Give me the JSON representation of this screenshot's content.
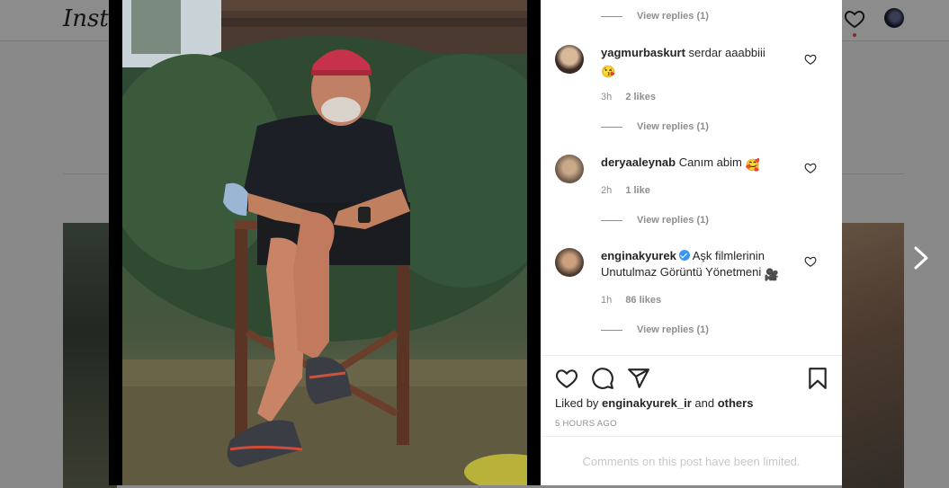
{
  "app": {
    "logo": "Instagram"
  },
  "post": {
    "comments": [
      {
        "user": "yagmurbaskurt",
        "text": "serdar aaabbiii",
        "emoji": "😘",
        "time": "3h",
        "likes": "2 likes",
        "view_replies": "View replies (1)",
        "verified": false
      },
      {
        "user": "deryaaleynab",
        "text": "Canım abim",
        "emoji": "🥰",
        "time": "2h",
        "likes": "1 like",
        "view_replies": "View replies (1)",
        "verified": false
      },
      {
        "user": "enginakyurek",
        "text": "Aşk filmlerinin Unutulmaz Görüntü Yönetmeni",
        "emoji": "🎥",
        "time": "1h",
        "likes": "86 likes",
        "view_replies": "View replies (1)",
        "verified": true
      }
    ],
    "top_view_replies": "View replies (1)",
    "liked_by_prefix": "Liked by",
    "liked_by_user": "enginakyurek_ir",
    "liked_by_and": "and",
    "liked_by_others": "others",
    "timestamp": "5 HOURS AGO",
    "comments_limited": "Comments on this post have been limited."
  },
  "colors": {
    "accent": "#3897f0",
    "text": "#262626",
    "muted": "#8e8e8e",
    "notification": "#ed4956"
  },
  "icons": [
    "heart-icon",
    "comment-icon",
    "share-icon",
    "bookmark-icon",
    "verified-icon",
    "chevron-right-icon",
    "avatar"
  ]
}
